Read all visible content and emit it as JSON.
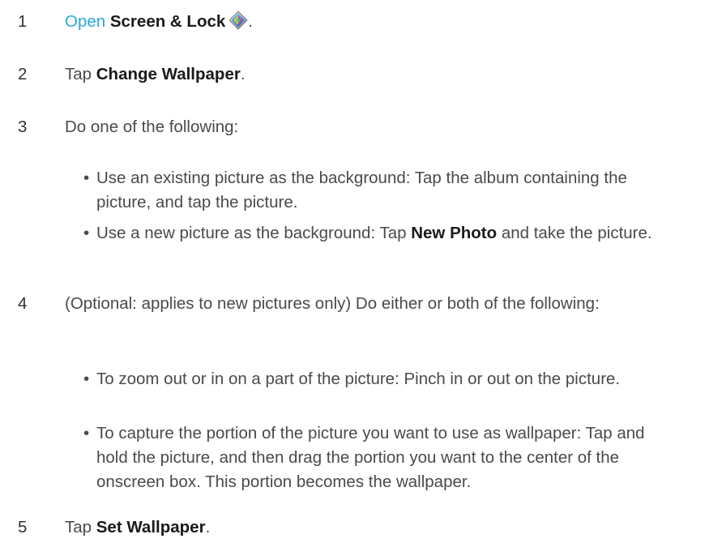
{
  "steps": [
    {
      "num": "1",
      "link": "Open",
      "bold": "Screen & Lock",
      "icon": "screen-and-lock-app-icon",
      "after": "."
    },
    {
      "num": "2",
      "before": "Tap ",
      "bold": "Change Wallpaper",
      "after": "."
    },
    {
      "num": "3",
      "text": "Do one of the following:",
      "bullets": [
        {
          "text": "Use an existing picture as the background: Tap the album containing the picture, and tap the picture."
        },
        {
          "before": "Use a new picture as the background: Tap ",
          "bold": "New Photo",
          "after": " and take the picture."
        }
      ]
    },
    {
      "num": "4",
      "text": "(Optional: applies to new pictures only) Do either or both of the following:",
      "bullets": [
        {
          "text": "To zoom out or in on a part of the picture: Pinch in or out on the picture."
        },
        {
          "text": "To capture the portion of the picture you want to use as wallpaper: Tap and hold the picture, and then drag the portion you want to the center of the onscreen box. This portion becomes the wallpaper."
        }
      ]
    },
    {
      "num": "5",
      "before": "Tap ",
      "bold": "Set Wallpaper",
      "after": "."
    }
  ],
  "bullet_char": "•",
  "colors": {
    "link": "#29a9e0",
    "text": "#4a4a4a",
    "bold": "#1a1a1a"
  }
}
